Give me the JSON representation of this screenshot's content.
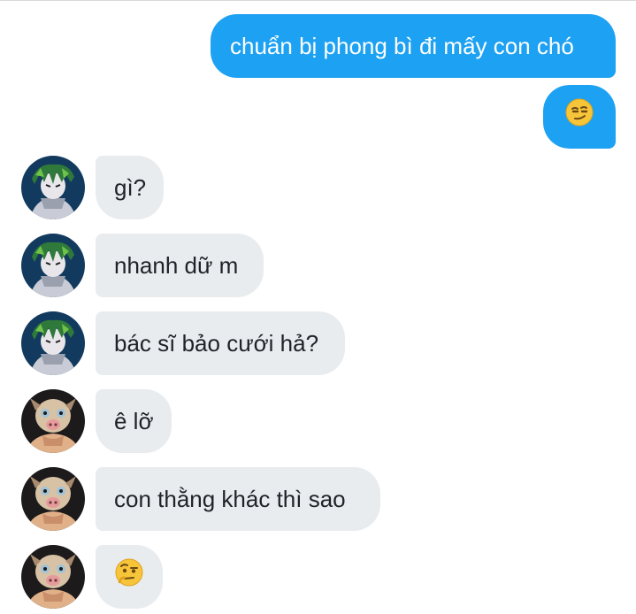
{
  "messages": [
    {
      "side": "sent",
      "text": "chuẩn bị phong bì đi mấy con chó"
    },
    {
      "side": "sent",
      "emoji": "smirking-face-emoji"
    },
    {
      "side": "received",
      "avatar": "green-hair-avatar",
      "text": "gì?"
    },
    {
      "side": "received",
      "avatar": "green-hair-avatar",
      "text": "nhanh dữ m"
    },
    {
      "side": "received",
      "avatar": "green-hair-avatar",
      "text": "bác sĩ bảo cưới hả?"
    },
    {
      "side": "received",
      "avatar": "boar-mask-avatar",
      "text": "ê lỡ"
    },
    {
      "side": "received",
      "avatar": "boar-mask-avatar",
      "text": "con thằng khác thì sao"
    },
    {
      "side": "received",
      "avatar": "boar-mask-avatar",
      "emoji": "face-with-raised-eyebrow-emoji"
    }
  ],
  "colors": {
    "sent_bubble": "#1da1f2",
    "received_bubble": "#e8ecef",
    "sent_text": "#ffffff",
    "received_text": "#1f2328"
  }
}
